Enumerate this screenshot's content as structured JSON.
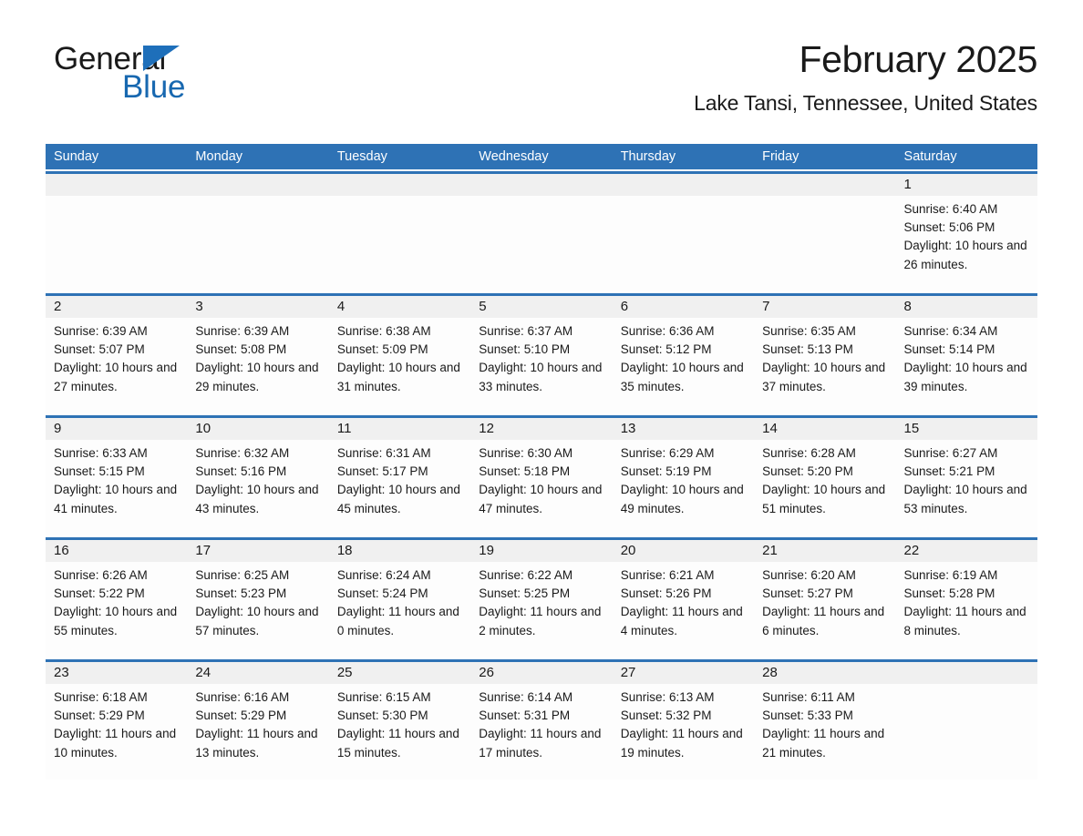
{
  "brand": {
    "name_part1": "General",
    "name_part2": "Blue",
    "flag_icon": "triangle-flag-icon",
    "color_blue": "#1868b0",
    "color_black": "#1a1a1a"
  },
  "header": {
    "title": "February 2025",
    "subtitle": "Lake Tansi, Tennessee, United States"
  },
  "theme": {
    "header_band": "#2e72b5",
    "day_band": "#f0f0f0",
    "cell_bg": "#fdfdfd"
  },
  "weekdays": [
    "Sunday",
    "Monday",
    "Tuesday",
    "Wednesday",
    "Thursday",
    "Friday",
    "Saturday"
  ],
  "labels": {
    "sunrise_prefix": "Sunrise:",
    "sunset_prefix": "Sunset:",
    "daylight_prefix": "Daylight:"
  },
  "weeks": [
    [
      {
        "day": "",
        "sunrise": "",
        "sunset": "",
        "daylight": "",
        "empty": true
      },
      {
        "day": "",
        "sunrise": "",
        "sunset": "",
        "daylight": "",
        "empty": true
      },
      {
        "day": "",
        "sunrise": "",
        "sunset": "",
        "daylight": "",
        "empty": true
      },
      {
        "day": "",
        "sunrise": "",
        "sunset": "",
        "daylight": "",
        "empty": true
      },
      {
        "day": "",
        "sunrise": "",
        "sunset": "",
        "daylight": "",
        "empty": true
      },
      {
        "day": "",
        "sunrise": "",
        "sunset": "",
        "daylight": "",
        "empty": true
      },
      {
        "day": "1",
        "sunrise": "Sunrise: 6:40 AM",
        "sunset": "Sunset: 5:06 PM",
        "daylight": "Daylight: 10 hours and 26 minutes.",
        "empty": false
      }
    ],
    [
      {
        "day": "2",
        "sunrise": "Sunrise: 6:39 AM",
        "sunset": "Sunset: 5:07 PM",
        "daylight": "Daylight: 10 hours and 27 minutes.",
        "empty": false
      },
      {
        "day": "3",
        "sunrise": "Sunrise: 6:39 AM",
        "sunset": "Sunset: 5:08 PM",
        "daylight": "Daylight: 10 hours and 29 minutes.",
        "empty": false
      },
      {
        "day": "4",
        "sunrise": "Sunrise: 6:38 AM",
        "sunset": "Sunset: 5:09 PM",
        "daylight": "Daylight: 10 hours and 31 minutes.",
        "empty": false
      },
      {
        "day": "5",
        "sunrise": "Sunrise: 6:37 AM",
        "sunset": "Sunset: 5:10 PM",
        "daylight": "Daylight: 10 hours and 33 minutes.",
        "empty": false
      },
      {
        "day": "6",
        "sunrise": "Sunrise: 6:36 AM",
        "sunset": "Sunset: 5:12 PM",
        "daylight": "Daylight: 10 hours and 35 minutes.",
        "empty": false
      },
      {
        "day": "7",
        "sunrise": "Sunrise: 6:35 AM",
        "sunset": "Sunset: 5:13 PM",
        "daylight": "Daylight: 10 hours and 37 minutes.",
        "empty": false
      },
      {
        "day": "8",
        "sunrise": "Sunrise: 6:34 AM",
        "sunset": "Sunset: 5:14 PM",
        "daylight": "Daylight: 10 hours and 39 minutes.",
        "empty": false
      }
    ],
    [
      {
        "day": "9",
        "sunrise": "Sunrise: 6:33 AM",
        "sunset": "Sunset: 5:15 PM",
        "daylight": "Daylight: 10 hours and 41 minutes.",
        "empty": false
      },
      {
        "day": "10",
        "sunrise": "Sunrise: 6:32 AM",
        "sunset": "Sunset: 5:16 PM",
        "daylight": "Daylight: 10 hours and 43 minutes.",
        "empty": false
      },
      {
        "day": "11",
        "sunrise": "Sunrise: 6:31 AM",
        "sunset": "Sunset: 5:17 PM",
        "daylight": "Daylight: 10 hours and 45 minutes.",
        "empty": false
      },
      {
        "day": "12",
        "sunrise": "Sunrise: 6:30 AM",
        "sunset": "Sunset: 5:18 PM",
        "daylight": "Daylight: 10 hours and 47 minutes.",
        "empty": false
      },
      {
        "day": "13",
        "sunrise": "Sunrise: 6:29 AM",
        "sunset": "Sunset: 5:19 PM",
        "daylight": "Daylight: 10 hours and 49 minutes.",
        "empty": false
      },
      {
        "day": "14",
        "sunrise": "Sunrise: 6:28 AM",
        "sunset": "Sunset: 5:20 PM",
        "daylight": "Daylight: 10 hours and 51 minutes.",
        "empty": false
      },
      {
        "day": "15",
        "sunrise": "Sunrise: 6:27 AM",
        "sunset": "Sunset: 5:21 PM",
        "daylight": "Daylight: 10 hours and 53 minutes.",
        "empty": false
      }
    ],
    [
      {
        "day": "16",
        "sunrise": "Sunrise: 6:26 AM",
        "sunset": "Sunset: 5:22 PM",
        "daylight": "Daylight: 10 hours and 55 minutes.",
        "empty": false
      },
      {
        "day": "17",
        "sunrise": "Sunrise: 6:25 AM",
        "sunset": "Sunset: 5:23 PM",
        "daylight": "Daylight: 10 hours and 57 minutes.",
        "empty": false
      },
      {
        "day": "18",
        "sunrise": "Sunrise: 6:24 AM",
        "sunset": "Sunset: 5:24 PM",
        "daylight": "Daylight: 11 hours and 0 minutes.",
        "empty": false
      },
      {
        "day": "19",
        "sunrise": "Sunrise: 6:22 AM",
        "sunset": "Sunset: 5:25 PM",
        "daylight": "Daylight: 11 hours and 2 minutes.",
        "empty": false
      },
      {
        "day": "20",
        "sunrise": "Sunrise: 6:21 AM",
        "sunset": "Sunset: 5:26 PM",
        "daylight": "Daylight: 11 hours and 4 minutes.",
        "empty": false
      },
      {
        "day": "21",
        "sunrise": "Sunrise: 6:20 AM",
        "sunset": "Sunset: 5:27 PM",
        "daylight": "Daylight: 11 hours and 6 minutes.",
        "empty": false
      },
      {
        "day": "22",
        "sunrise": "Sunrise: 6:19 AM",
        "sunset": "Sunset: 5:28 PM",
        "daylight": "Daylight: 11 hours and 8 minutes.",
        "empty": false
      }
    ],
    [
      {
        "day": "23",
        "sunrise": "Sunrise: 6:18 AM",
        "sunset": "Sunset: 5:29 PM",
        "daylight": "Daylight: 11 hours and 10 minutes.",
        "empty": false
      },
      {
        "day": "24",
        "sunrise": "Sunrise: 6:16 AM",
        "sunset": "Sunset: 5:29 PM",
        "daylight": "Daylight: 11 hours and 13 minutes.",
        "empty": false
      },
      {
        "day": "25",
        "sunrise": "Sunrise: 6:15 AM",
        "sunset": "Sunset: 5:30 PM",
        "daylight": "Daylight: 11 hours and 15 minutes.",
        "empty": false
      },
      {
        "day": "26",
        "sunrise": "Sunrise: 6:14 AM",
        "sunset": "Sunset: 5:31 PM",
        "daylight": "Daylight: 11 hours and 17 minutes.",
        "empty": false
      },
      {
        "day": "27",
        "sunrise": "Sunrise: 6:13 AM",
        "sunset": "Sunset: 5:32 PM",
        "daylight": "Daylight: 11 hours and 19 minutes.",
        "empty": false
      },
      {
        "day": "28",
        "sunrise": "Sunrise: 6:11 AM",
        "sunset": "Sunset: 5:33 PM",
        "daylight": "Daylight: 11 hours and 21 minutes.",
        "empty": false
      },
      {
        "day": "",
        "sunrise": "",
        "sunset": "",
        "daylight": "",
        "empty": true
      }
    ]
  ]
}
